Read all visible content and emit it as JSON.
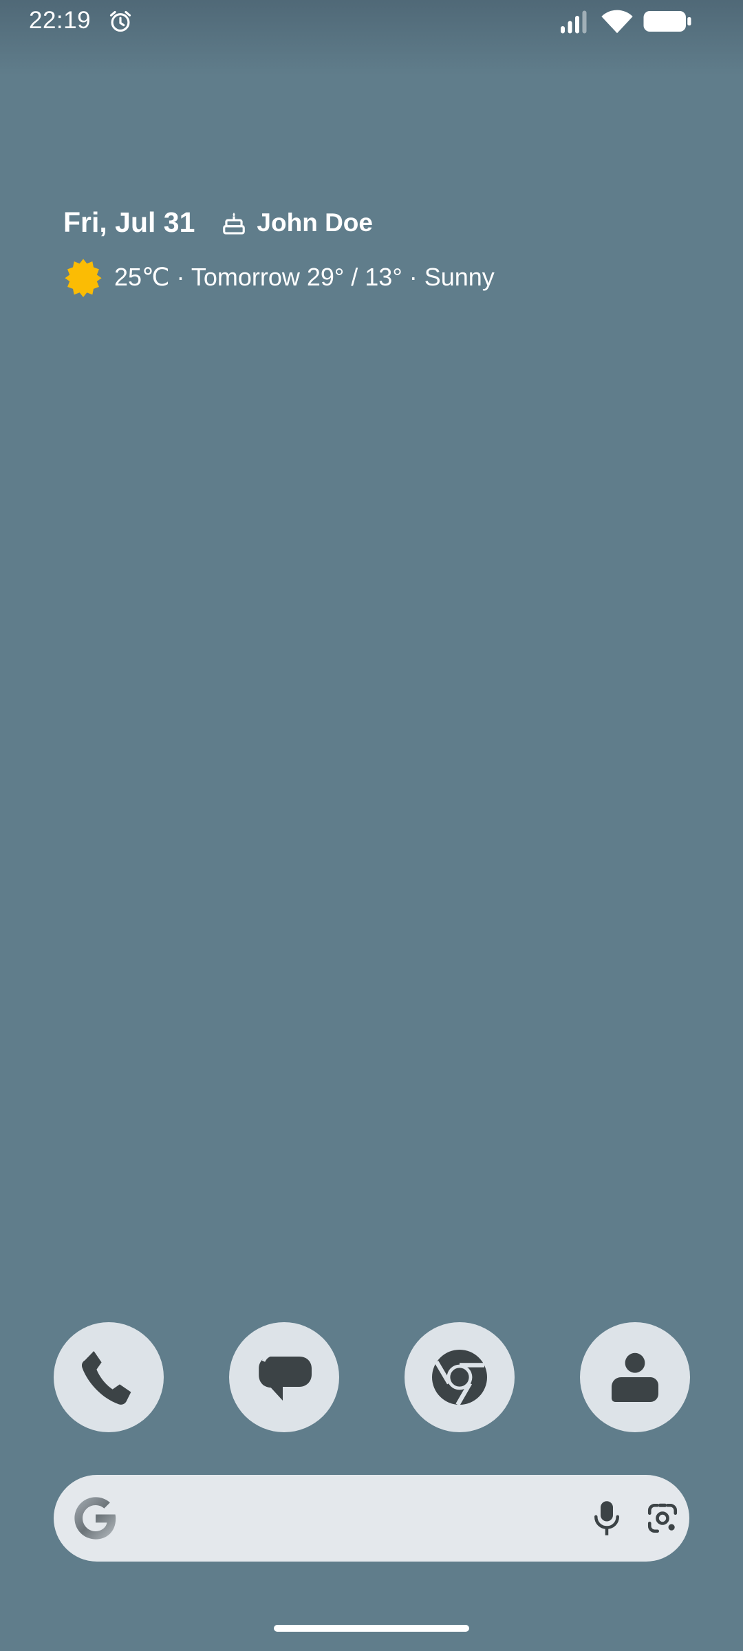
{
  "status_bar": {
    "time": "22:19",
    "icons": [
      "alarm-icon",
      "signal-icon",
      "wifi-icon",
      "battery-icon"
    ]
  },
  "glance": {
    "date": "Fri, Jul 31",
    "event_icon": "cake-icon",
    "event": "John Doe",
    "weather_icon": "sun-icon",
    "weather": "25℃ · Tomorrow 29° / 13° · Sunny"
  },
  "dock": {
    "apps": [
      {
        "icon": "phone-icon"
      },
      {
        "icon": "messages-icon"
      },
      {
        "icon": "chrome-icon"
      },
      {
        "icon": "contacts-icon"
      }
    ]
  },
  "search": {
    "logo": "google-g-icon",
    "placeholder": "",
    "icons": [
      "mic-icon",
      "lens-icon"
    ]
  },
  "colors": {
    "wallpaper": "#607d8b",
    "dock_icon_bg": "#dde3e8",
    "icon_glyph": "#3c4346",
    "search_bg": "#e4e8ec",
    "sun": "#fbbc04"
  }
}
